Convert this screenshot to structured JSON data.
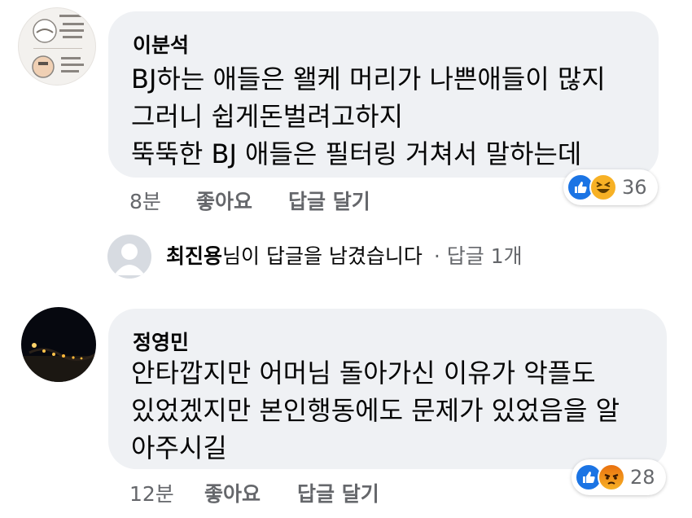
{
  "comments": [
    {
      "author": "이분석",
      "lines": [
        "BJ하는 애들은 왤케 머리가 나쁜애들이 많지",
        "그러니 쉽게돈벌려고하지",
        "뚝뚝한 BJ 애들은 필터링 거쳐서 말하는데"
      ],
      "time": "8분",
      "like_label": "좋아요",
      "reply_label": "답글 달기",
      "reactions": [
        "like",
        "haha"
      ],
      "reaction_count": "36"
    },
    {
      "author": "정영민",
      "lines": [
        "안타깝지만 어머님 돌아가신 이유가 악플도",
        "있었겠지만 본인행동에도 문제가 있었음을 알",
        "아주시길"
      ],
      "time": "12분",
      "like_label": "좋아요",
      "reply_label": "답글 달기",
      "reactions": [
        "like",
        "angry"
      ],
      "reaction_count": "28"
    }
  ],
  "reply_thread": {
    "name": "최진용",
    "suffix": "님이 답글을 남겼습니다",
    "count": "· 답글 1개"
  },
  "colors": {
    "bubble": "#eff1f4",
    "meta": "#65676b",
    "like": "#1b74e4",
    "haha": "#f7b125",
    "angry": "#e9710f"
  }
}
